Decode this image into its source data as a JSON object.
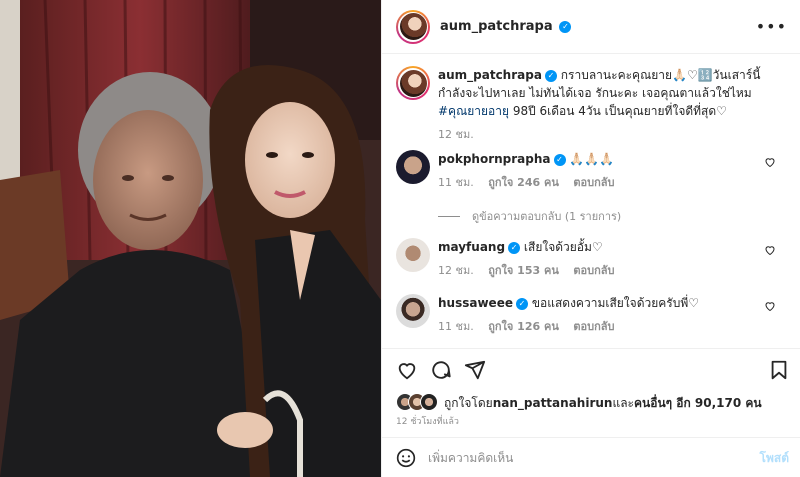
{
  "header": {
    "username": "aum_patchrapa",
    "verified": true,
    "more_label": "•••"
  },
  "caption": {
    "username": "aum_patchrapa",
    "text_part1": "กราบลานะคะคุณยาย🙏🏻♡🔢วันเสาร์นี้กำลังจะไปหาเลย ไม่ทันได้เจอ รักนะคะ เจอคุณตาแล้วใช่ไหม ",
    "hashtag": "#คุณยายอายุ",
    "text_part2": " 98ปี 6เดือน 4วัน เป็นคุณยายที่ใจดีที่สุด♡",
    "time": "12 ชม."
  },
  "comments": [
    {
      "username": "pokphornprapha",
      "verified": true,
      "text": "🙏🏻🙏🏻🙏🏻",
      "time": "11 ชม.",
      "likes": "ถูกใจ 246 คน",
      "reply_label": "ตอบกลับ",
      "avatar_colors": [
        "#1b1b2e",
        "#c9a38a"
      ]
    },
    {
      "username": "mayfuang",
      "verified": true,
      "text": "เสียใจด้วยอั้ม♡",
      "time": "12 ชม.",
      "likes": "ถูกใจ 153 คน",
      "reply_label": "ตอบกลับ",
      "avatar_colors": [
        "#e9e4df",
        "#b08a72"
      ]
    },
    {
      "username": "hussaweee",
      "verified": true,
      "text": "ขอแสดงความเสียใจด้วยครับพี่♡",
      "time": "11 ชม.",
      "likes": "ถูกใจ 126 คน",
      "reply_label": "ตอบกลับ",
      "avatar_colors": [
        "#dcdcdc",
        "#3a2a24"
      ]
    }
  ],
  "view_replies": "ดูข้อความตอบกลับ (1 รายการ)",
  "likes_summary": {
    "prefix": "ถูกใจโดย ",
    "user": "nan_pattanahirun",
    "middle": " และ",
    "others": "คนอื่นๆ อีก 90,170 คน"
  },
  "time_ago": "12 ชั่วโมงที่แล้ว",
  "add_comment": {
    "placeholder": "เพิ่มความคิดเห็น",
    "post_label": "โพสต์"
  },
  "colors": {
    "accent": "#0095f6",
    "post_disabled": "#b2dffc",
    "hashtag": "#00376b",
    "muted": "#8e8e8e"
  },
  "icons": [
    "heart-icon",
    "comment-icon",
    "share-icon",
    "bookmark-icon",
    "emoji-icon",
    "verified-icon",
    "more-icon"
  ]
}
